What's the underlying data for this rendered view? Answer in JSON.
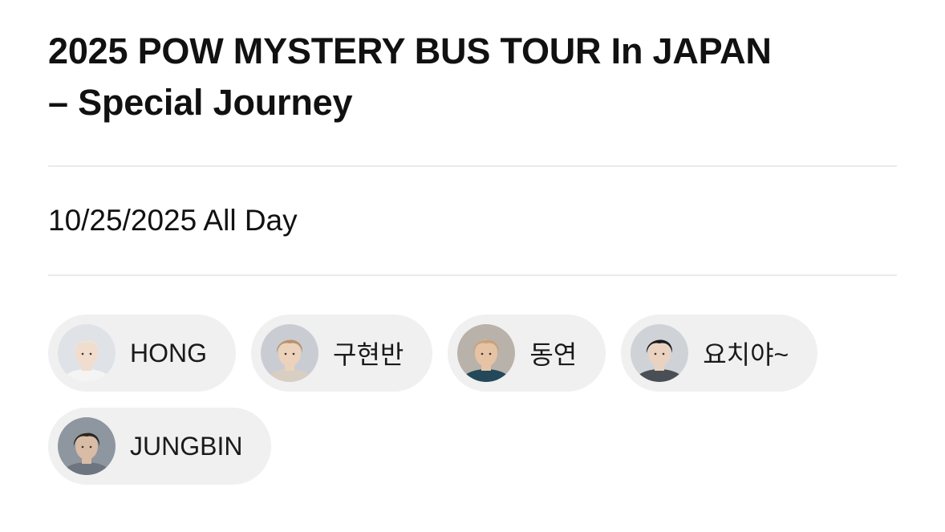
{
  "event": {
    "title_line1": "2025 POW MYSTERY BUS TOUR In JAPAN",
    "title_line2": "– Special Journey",
    "date": "10/25/2025 All Day"
  },
  "members": [
    {
      "name": "HONG",
      "avatar": "member-photo",
      "hair": "#e8e4d8",
      "skin": "#f1dccd",
      "shirt": "#f4f4f4",
      "bg": "#dfe3e8"
    },
    {
      "name": "구현반",
      "avatar": "member-photo",
      "hair": "#b8926c",
      "skin": "#ecd2bb",
      "shirt": "#d8cfc2",
      "bg": "#c9cdd3"
    },
    {
      "name": "동연",
      "avatar": "member-photo",
      "hair": "#c8a27a",
      "skin": "#e6c3a5",
      "shirt": "#23485a",
      "bg": "#b9b2aa"
    },
    {
      "name": "요치야~",
      "avatar": "member-photo",
      "hair": "#1b1b1f",
      "skin": "#ead2c0",
      "shirt": "#4a4f55",
      "bg": "#cfd3d8"
    },
    {
      "name": "JUNGBIN",
      "avatar": "member-photo",
      "hair": "#2a2624",
      "skin": "#d9bca5",
      "shirt": "#6d7580",
      "bg": "#8e969f"
    }
  ]
}
